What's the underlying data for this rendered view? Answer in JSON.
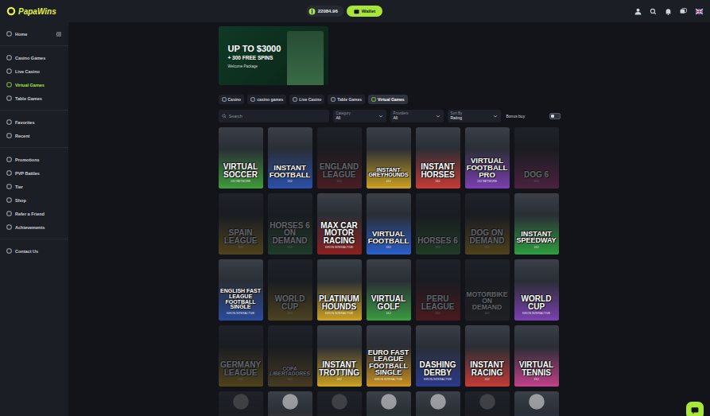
{
  "logo": {
    "text": "PapaWins"
  },
  "balance": {
    "amount": "22084.96"
  },
  "wallet_button": "Wallet",
  "sidebar": {
    "sections": [
      [
        {
          "label": "Home",
          "selected": false
        }
      ],
      [
        {
          "label": "Casino Games",
          "selected": false
        },
        {
          "label": "Live Casino",
          "selected": false
        },
        {
          "label": "Virtual Games",
          "selected": true
        },
        {
          "label": "Table Games",
          "selected": false
        }
      ],
      [
        {
          "label": "Favorites",
          "selected": false
        },
        {
          "label": "Recent",
          "selected": false
        }
      ],
      [
        {
          "label": "Promotions",
          "selected": false
        },
        {
          "label": "PVP Battles",
          "selected": false
        },
        {
          "label": "Tier",
          "selected": false
        },
        {
          "label": "Shop",
          "selected": false
        },
        {
          "label": "Refer a Friend",
          "selected": false
        },
        {
          "label": "Achievements",
          "selected": false
        }
      ],
      [
        {
          "label": "Contact Us",
          "selected": false
        }
      ]
    ]
  },
  "banner": {
    "headline": "UP TO $3000",
    "subline": "+ 300 FREE SPINS",
    "badge": "Welcome Package"
  },
  "tabs": [
    {
      "label": "Casino",
      "selected": false
    },
    {
      "label": "casino games",
      "selected": false
    },
    {
      "label": "Live Casino",
      "selected": false
    },
    {
      "label": "Table Games",
      "selected": false
    },
    {
      "label": "Virtual Games",
      "selected": true
    }
  ],
  "filters": {
    "search_placeholder": "Search",
    "dropdowns": [
      {
        "label": "Category",
        "value": "All"
      },
      {
        "label": "Providers",
        "value": "All"
      },
      {
        "label": "Sort By",
        "value": "Rating"
      }
    ],
    "bonus_buy": {
      "label": "Bonus buy",
      "on": false
    }
  },
  "games": [
    {
      "kind": "tile",
      "title": "VIRTUAL SOCCER",
      "provider": "1X2 NETWORK",
      "dimmed": false,
      "color": "#3e9a3a"
    },
    {
      "kind": "tile",
      "title": "INSTANT FOOTBALL",
      "provider": "1X2",
      "dimmed": false,
      "color": "#2a4fa8"
    },
    {
      "kind": "tile",
      "title": "ENGLAND LEAGUE",
      "provider": "1X2",
      "dimmed": true,
      "color": "#b8333a"
    },
    {
      "kind": "tile",
      "title": "INSTANT GREYHOUNDS",
      "provider": "1X2",
      "dimmed": false,
      "color": "#c9a020"
    },
    {
      "kind": "tile",
      "title": "INSTANT HORSES",
      "provider": "1X2",
      "dimmed": false,
      "color": "#c43a35"
    },
    {
      "kind": "tile",
      "title": "VIRTUAL FOOTBALL PRO",
      "provider": "1X2 NETWORK",
      "dimmed": false,
      "color": "#7a3fb0"
    },
    {
      "kind": "tile",
      "title": "DOG 6",
      "provider": "1X2",
      "dimmed": true,
      "color": "#c0408a"
    },
    {
      "kind": "tile",
      "title": "SPAIN LEAGUE",
      "provider": "1X2",
      "dimmed": true,
      "color": "#c8a026"
    },
    {
      "kind": "tile",
      "title": "HORSES 6 ON DEMAND",
      "provider": "1X2",
      "dimmed": true,
      "color": "#3b8a4a"
    },
    {
      "kind": "tile",
      "title": "MAX CAR MOTOR RACING",
      "provider": "KIRON INTERACTIVE",
      "dimmed": false,
      "color": "#8a2020"
    },
    {
      "kind": "tile",
      "title": "VIRTUAL FOOTBALL",
      "provider": "1X2",
      "dimmed": false,
      "color": "#2a5ec8"
    },
    {
      "kind": "tile",
      "title": "HORSES 6",
      "provider": "1X2",
      "dimmed": true,
      "color": "#3a8a40"
    },
    {
      "kind": "tile",
      "title": "DOG ON DEMAND",
      "provider": "1X2",
      "dimmed": true,
      "color": "#c9a020"
    },
    {
      "kind": "tile",
      "title": "INSTANT SPEEDWAY",
      "provider": "1X2",
      "dimmed": false,
      "color": "#2e9a3e"
    },
    {
      "kind": "tile",
      "title": "ENGLISH FAST LEAGUE FOOTBALL SINGLE",
      "provider": "KIRON INTERACTIVE",
      "dimmed": false,
      "color": "#2a4a9a"
    },
    {
      "kind": "tile",
      "title": "WORLD CUP",
      "provider": "1X2",
      "dimmed": true,
      "color": "#c0a030"
    },
    {
      "kind": "tile",
      "title": "PLATINUM HOUNDS",
      "provider": "KIRON INTERACTIVE",
      "dimmed": false,
      "color": "#c9a020"
    },
    {
      "kind": "tile",
      "title": "VIRTUAL GOLF",
      "provider": "1X2",
      "dimmed": false,
      "color": "#3a9a40"
    },
    {
      "kind": "tile",
      "title": "PERU LEAGUE",
      "provider": "1X2",
      "dimmed": true,
      "color": "#b82828"
    },
    {
      "kind": "tile",
      "title": "MOTORBIKE ON DEMAND",
      "provider": "1X2",
      "dimmed": true,
      "color": "#3a3a3a"
    },
    {
      "kind": "tile",
      "title": "WORLD CUP",
      "provider": "KIRON INTERACTIVE",
      "dimmed": false,
      "color": "#7a3fb0"
    },
    {
      "kind": "tile",
      "title": "GERMANY LEAGUE",
      "provider": "1X2",
      "dimmed": true,
      "color": "#c9a020"
    },
    {
      "kind": "tile",
      "title": "COPA LIBERTADORES",
      "provider": "1X2",
      "dimmed": true,
      "color": "#b08a30"
    },
    {
      "kind": "tile",
      "title": "INSTANT TROTTING",
      "provider": "1X2",
      "dimmed": false,
      "color": "#c9a020"
    },
    {
      "kind": "tile",
      "title": "EURO FAST LEAGUE FOOTBALL SINGLE",
      "provider": "KIRON INTERACTIVE",
      "dimmed": false,
      "color": "#c99020"
    },
    {
      "kind": "tile",
      "title": "DASHING DERBY",
      "provider": "KIRON INTERACTIVE",
      "dimmed": false,
      "color": "#2a3a8a"
    },
    {
      "kind": "tile",
      "title": "INSTANT RACING",
      "provider": "1X2",
      "dimmed": false,
      "color": "#c43a35"
    },
    {
      "kind": "tile",
      "title": "VIRTUAL TENNIS",
      "provider": "1X2",
      "dimmed": false,
      "color": "#c0408a"
    },
    {
      "kind": "partial",
      "dimmed": true,
      "color": "#8a8a8a"
    },
    {
      "kind": "partial",
      "dimmed": false,
      "color": "#d0702a"
    },
    {
      "kind": "partial",
      "dimmed": true,
      "color": "#c9a020"
    },
    {
      "kind": "partial",
      "dimmed": false,
      "color": "#3a9a40"
    },
    {
      "kind": "partial",
      "dimmed": false,
      "color": "#5a6a3a"
    },
    {
      "kind": "partial",
      "dimmed": true,
      "color": "#b82828"
    },
    {
      "kind": "partial",
      "dimmed": false,
      "color": "#2a4fa8"
    }
  ]
}
